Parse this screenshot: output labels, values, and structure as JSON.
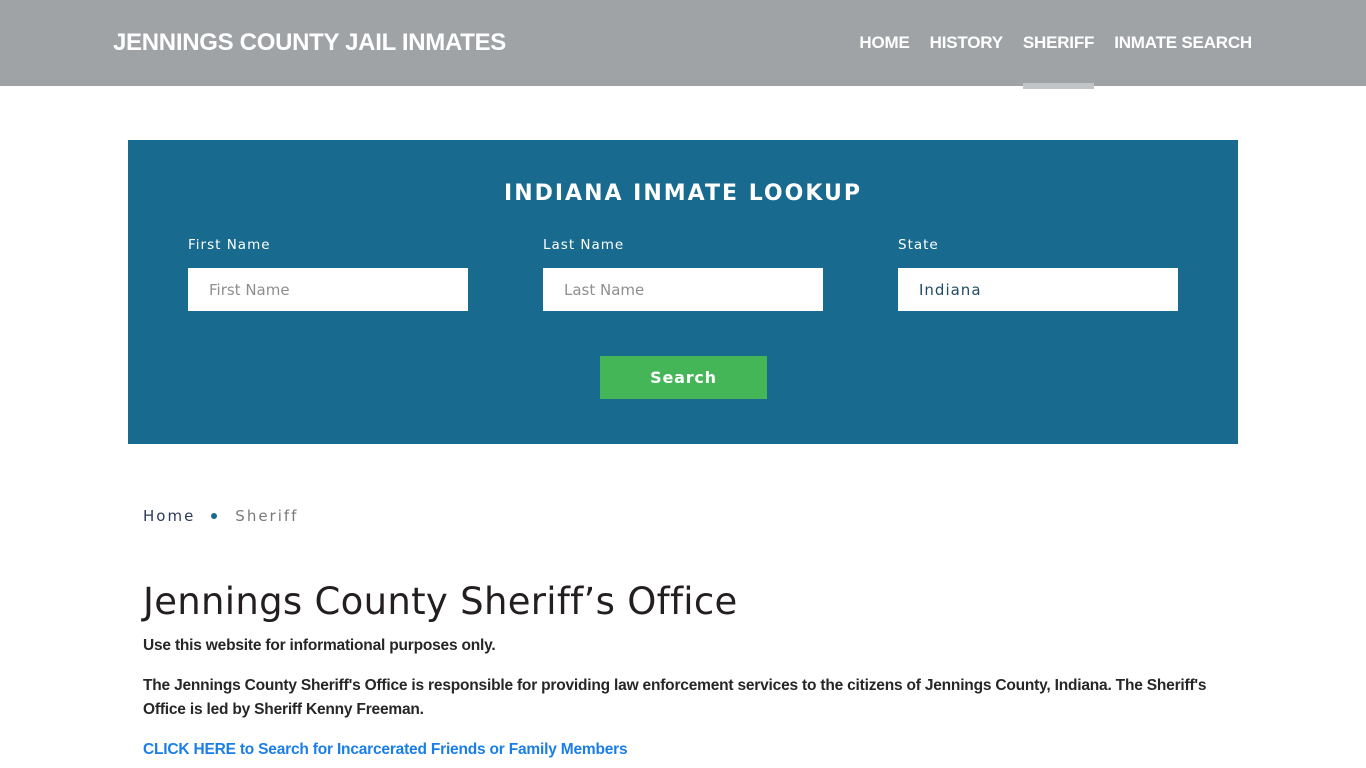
{
  "header": {
    "brand": "JENNINGS COUNTY JAIL INMATES",
    "nav": [
      {
        "label": "HOME",
        "active": false
      },
      {
        "label": "HISTORY",
        "active": false
      },
      {
        "label": "SHERIFF",
        "active": true
      },
      {
        "label": "INMATE SEARCH",
        "active": false
      }
    ]
  },
  "lookup": {
    "title": "INDIANA INMATE LOOKUP",
    "first_name": {
      "label": "First Name",
      "placeholder": "First Name",
      "value": ""
    },
    "last_name": {
      "label": "Last Name",
      "placeholder": "Last Name",
      "value": ""
    },
    "state": {
      "label": "State",
      "value": "Indiana"
    },
    "search_label": "Search"
  },
  "breadcrumb": {
    "home": "Home",
    "current": "Sheriff"
  },
  "content": {
    "title": "Jennings County Sheriff’s Office",
    "paragraphs": [
      "Use this website for informational purposes only.",
      "The Jennings County Sheriff's Office is responsible for providing law enforcement services to the citizens of Jennings County, Indiana. The Sheriff's Office is led by Sheriff Kenny Freeman."
    ],
    "cta_link": "CLICK HERE to Search for Incarcerated Friends or Family Members"
  },
  "colors": {
    "header_bg": "#9fa3a6",
    "lookup_bg": "#186a8e",
    "search_button": "#45b658",
    "link": "#1a7ee8"
  }
}
